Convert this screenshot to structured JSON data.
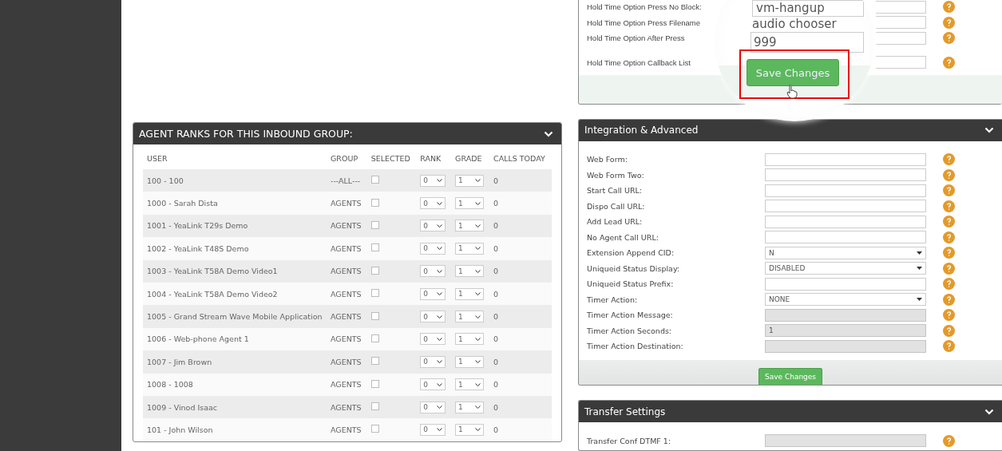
{
  "top_panel": {
    "rows": [
      {
        "label": "Hold Time Option Press No Block:"
      },
      {
        "label": "Hold Time Option Press Filename"
      },
      {
        "label": "Hold Time Option After Press"
      },
      {
        "label": "Hold Time Option Callback List"
      }
    ]
  },
  "magnifier": {
    "select_value": "vm-hangup",
    "text": "audio chooser",
    "field_value": "999",
    "button": "Save Changes",
    "highlighted": true
  },
  "agent_ranks": {
    "title": "AGENT RANKS FOR THIS INBOUND GROUP:",
    "columns": [
      "USER",
      "GROUP",
      "SELECTED",
      "RANK",
      "GRADE",
      "CALLS TODAY"
    ],
    "rows": [
      {
        "user": "100 - 100",
        "group": "---ALL---",
        "selected": false,
        "rank": "0",
        "grade": "1",
        "calls_today": "0"
      },
      {
        "user": "1000 - Sarah Dista",
        "group": "AGENTS",
        "selected": false,
        "rank": "0",
        "grade": "1",
        "calls_today": "0"
      },
      {
        "user": "1001 - YeaLink T29s Demo",
        "group": "AGENTS",
        "selected": false,
        "rank": "0",
        "grade": "1",
        "calls_today": "0"
      },
      {
        "user": "1002 - YeaLink T48S Demo",
        "group": "AGENTS",
        "selected": false,
        "rank": "0",
        "grade": "1",
        "calls_today": "0"
      },
      {
        "user": "1003 - YeaLink T58A Demo Video1",
        "group": "AGENTS",
        "selected": false,
        "rank": "0",
        "grade": "1",
        "calls_today": "0"
      },
      {
        "user": "1004 - YeaLink T58A Demo Video2",
        "group": "AGENTS",
        "selected": false,
        "rank": "0",
        "grade": "1",
        "calls_today": "0"
      },
      {
        "user": "1005 - Grand Stream Wave Mobile Application",
        "group": "AGENTS",
        "selected": false,
        "rank": "0",
        "grade": "1",
        "calls_today": "0"
      },
      {
        "user": "1006 - Web-phone Agent 1",
        "group": "AGENTS",
        "selected": false,
        "rank": "0",
        "grade": "1",
        "calls_today": "0"
      },
      {
        "user": "1007 - Jim Brown",
        "group": "AGENTS",
        "selected": false,
        "rank": "0",
        "grade": "1",
        "calls_today": "0"
      },
      {
        "user": "1008 - 1008",
        "group": "AGENTS",
        "selected": false,
        "rank": "0",
        "grade": "1",
        "calls_today": "0"
      },
      {
        "user": "1009 - Vinod Isaac",
        "group": "AGENTS",
        "selected": false,
        "rank": "0",
        "grade": "1",
        "calls_today": "0"
      },
      {
        "user": "101 - John Wilson",
        "group": "AGENTS",
        "selected": false,
        "rank": "0",
        "grade": "1",
        "calls_today": "0"
      }
    ]
  },
  "integration": {
    "title": "Integration & Advanced",
    "fields": [
      {
        "label": "Web Form:",
        "kind": "text",
        "disabled": false
      },
      {
        "label": "Web Form Two:",
        "kind": "text",
        "disabled": false
      },
      {
        "label": "Start Call URL:",
        "kind": "text",
        "disabled": false
      },
      {
        "label": "Dispo Call URL:",
        "kind": "text",
        "disabled": false
      },
      {
        "label": "Add Lead URL:",
        "kind": "text",
        "disabled": false
      },
      {
        "label": "No Agent Call URL:",
        "kind": "text",
        "disabled": false
      },
      {
        "label": "Extension Append CID:",
        "kind": "select",
        "value": "N",
        "disabled": false
      },
      {
        "label": "Uniqueid Status Display:",
        "kind": "select",
        "value": "DISABLED",
        "disabled": false
      },
      {
        "label": "Uniqueid Status Prefix:",
        "kind": "text",
        "disabled": false
      },
      {
        "label": "Timer Action:",
        "kind": "select",
        "value": "NONE",
        "disabled": false
      },
      {
        "label": "Timer Action Message:",
        "kind": "text",
        "disabled": true
      },
      {
        "label": "Timer Action Seconds:",
        "kind": "text",
        "value": "1",
        "disabled": true
      },
      {
        "label": "Timer Action Destination:",
        "kind": "text",
        "disabled": true
      }
    ],
    "button": "Save Changes"
  },
  "transfer": {
    "title": "Transfer Settings",
    "fields": [
      {
        "label": "Transfer Conf DTMF 1:",
        "kind": "text",
        "disabled": true
      }
    ]
  }
}
